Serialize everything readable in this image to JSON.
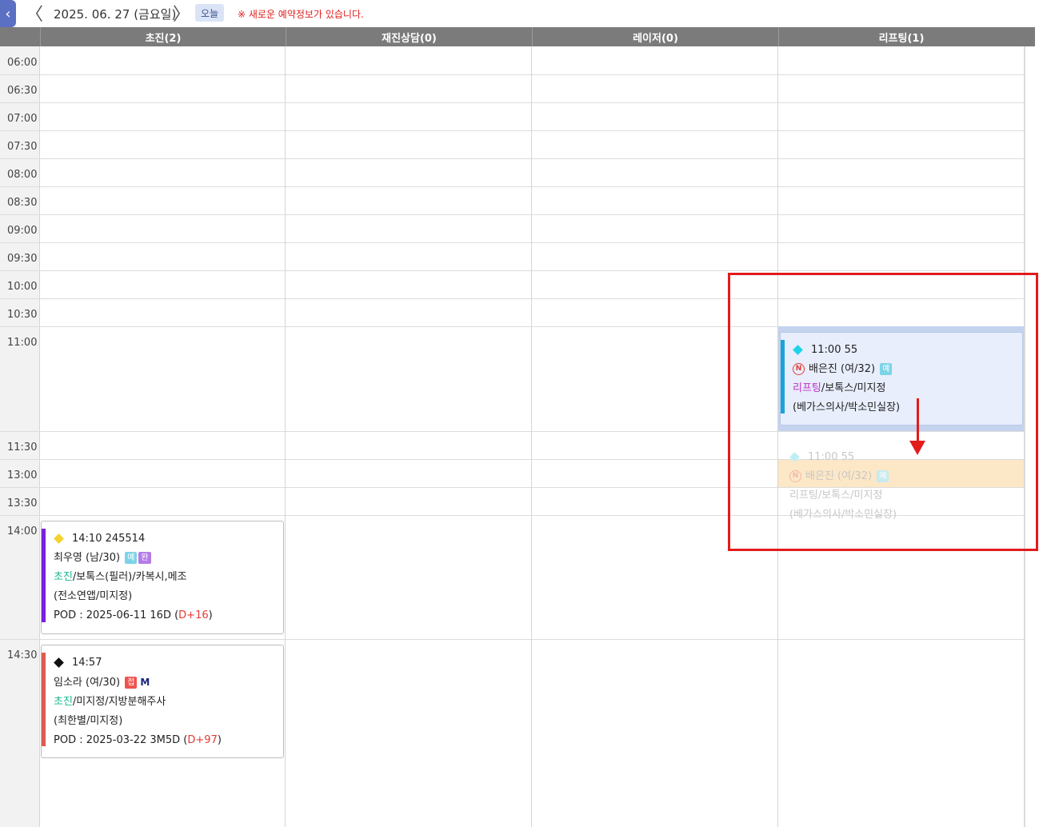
{
  "toolbar": {
    "collapse_icon": "chevron-left-icon",
    "prev_icon": "chevron-left-icon",
    "next_icon": "chevron-right-icon",
    "date": "2025. 06. 27 (금요일)",
    "today_label": "오늘",
    "notice": "※ 새로운 예약정보가 있습니다."
  },
  "columns": [
    {
      "label": "초진(2)"
    },
    {
      "label": "재진상담(0)"
    },
    {
      "label": "레이저(0)"
    },
    {
      "label": "리프팅(1)"
    }
  ],
  "times": [
    "06:00",
    "06:30",
    "07:00",
    "07:30",
    "08:00",
    "08:30",
    "09:00",
    "09:30",
    "10:00",
    "10:30",
    "11:00",
    "11:30",
    "13:00",
    "13:30",
    "14:00",
    "14:30"
  ],
  "appointments": {
    "a1": {
      "time_id": "14:10 245514",
      "patient": "최우영 (남/30)",
      "badge1": "예",
      "badge2": "완",
      "category": "초진",
      "detail": "/보톡스(필러)/카복시,메조",
      "staff": "(전소연앱/미지정)",
      "pod_text": "POD : 2025-06-11 16D (",
      "pod_d": "D+16",
      "pod_close": ")",
      "colors": {
        "bar": "#7b1fe0",
        "diamond": "#f5d22e",
        "category": "#17b890",
        "badge1": "#7dd3e6",
        "badge2": "#b57be8"
      }
    },
    "a2": {
      "time_id": "14:57",
      "patient": "임소라 (여/30)",
      "badge1": "접",
      "badge2": "M",
      "category": "초진",
      "detail": "/미지정/지방분해주사",
      "staff": "(최한별/미지정)",
      "pod_text": "POD : 2025-03-22 3M5D (",
      "pod_d": "D+97",
      "pod_close": ")",
      "colors": {
        "bar": "#e05a4e",
        "diamond": "#111111",
        "category": "#17b890",
        "badge1": "#ef5350"
      }
    },
    "a3": {
      "time_id": "11:00 55",
      "n_mark": "N",
      "patient": "배은진 (여/32)",
      "badge1": "예",
      "category": "리프팅",
      "detail": "/보톡스/미지정",
      "staff": "(베가스의사/박소민실장)",
      "colors": {
        "bar": "#1aa3d9",
        "diamond": "#1ed3e8",
        "category": "#c02ec9",
        "badge1": "#7dd3e6"
      }
    },
    "ghost": {
      "time_id": "11:00 55",
      "n_mark": "N",
      "patient": "배은진 (여/32)",
      "badge1": "예",
      "detail": "리프팅/보톡스/미지정",
      "staff": "(베가스의사/박소민실장)"
    }
  },
  "annotation": {
    "color": "#e21b1b"
  }
}
